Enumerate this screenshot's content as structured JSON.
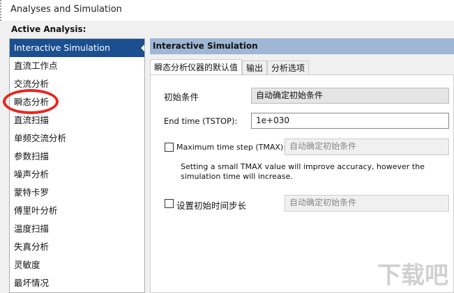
{
  "window": {
    "title": "Analyses and Simulation"
  },
  "active_analysis_label": "Active Analysis:",
  "analyses": [
    "Interactive Simulation",
    "直流工作点",
    "交流分析",
    "瞬态分析",
    "直流扫描",
    "单频交流分析",
    "参数扫描",
    "噪声分析",
    "蒙特卡罗",
    "傅里叶分析",
    "温度扫描",
    "失真分析",
    "灵敏度",
    "最坏情况"
  ],
  "panel": {
    "header": "Interactive Simulation",
    "tabs": [
      "瞬态分析仪器的默认值",
      "输出",
      "分析选项"
    ],
    "initial_conditions_label": "初始条件",
    "initial_conditions_value": "自动确定初始条件",
    "end_time_label": "End time (TSTOP):",
    "end_time_value": "1e+030",
    "tmax_label": "Maximum time step (TMAX):",
    "tmax_value": "自动确定初始条件",
    "tmax_help": "Setting a small TMAX value will improve accuracy, however the simulation time will increase.",
    "initial_step_label": "设置初始时间步长",
    "initial_step_value": "自动确定初始条件"
  },
  "watermark": "下载吧"
}
